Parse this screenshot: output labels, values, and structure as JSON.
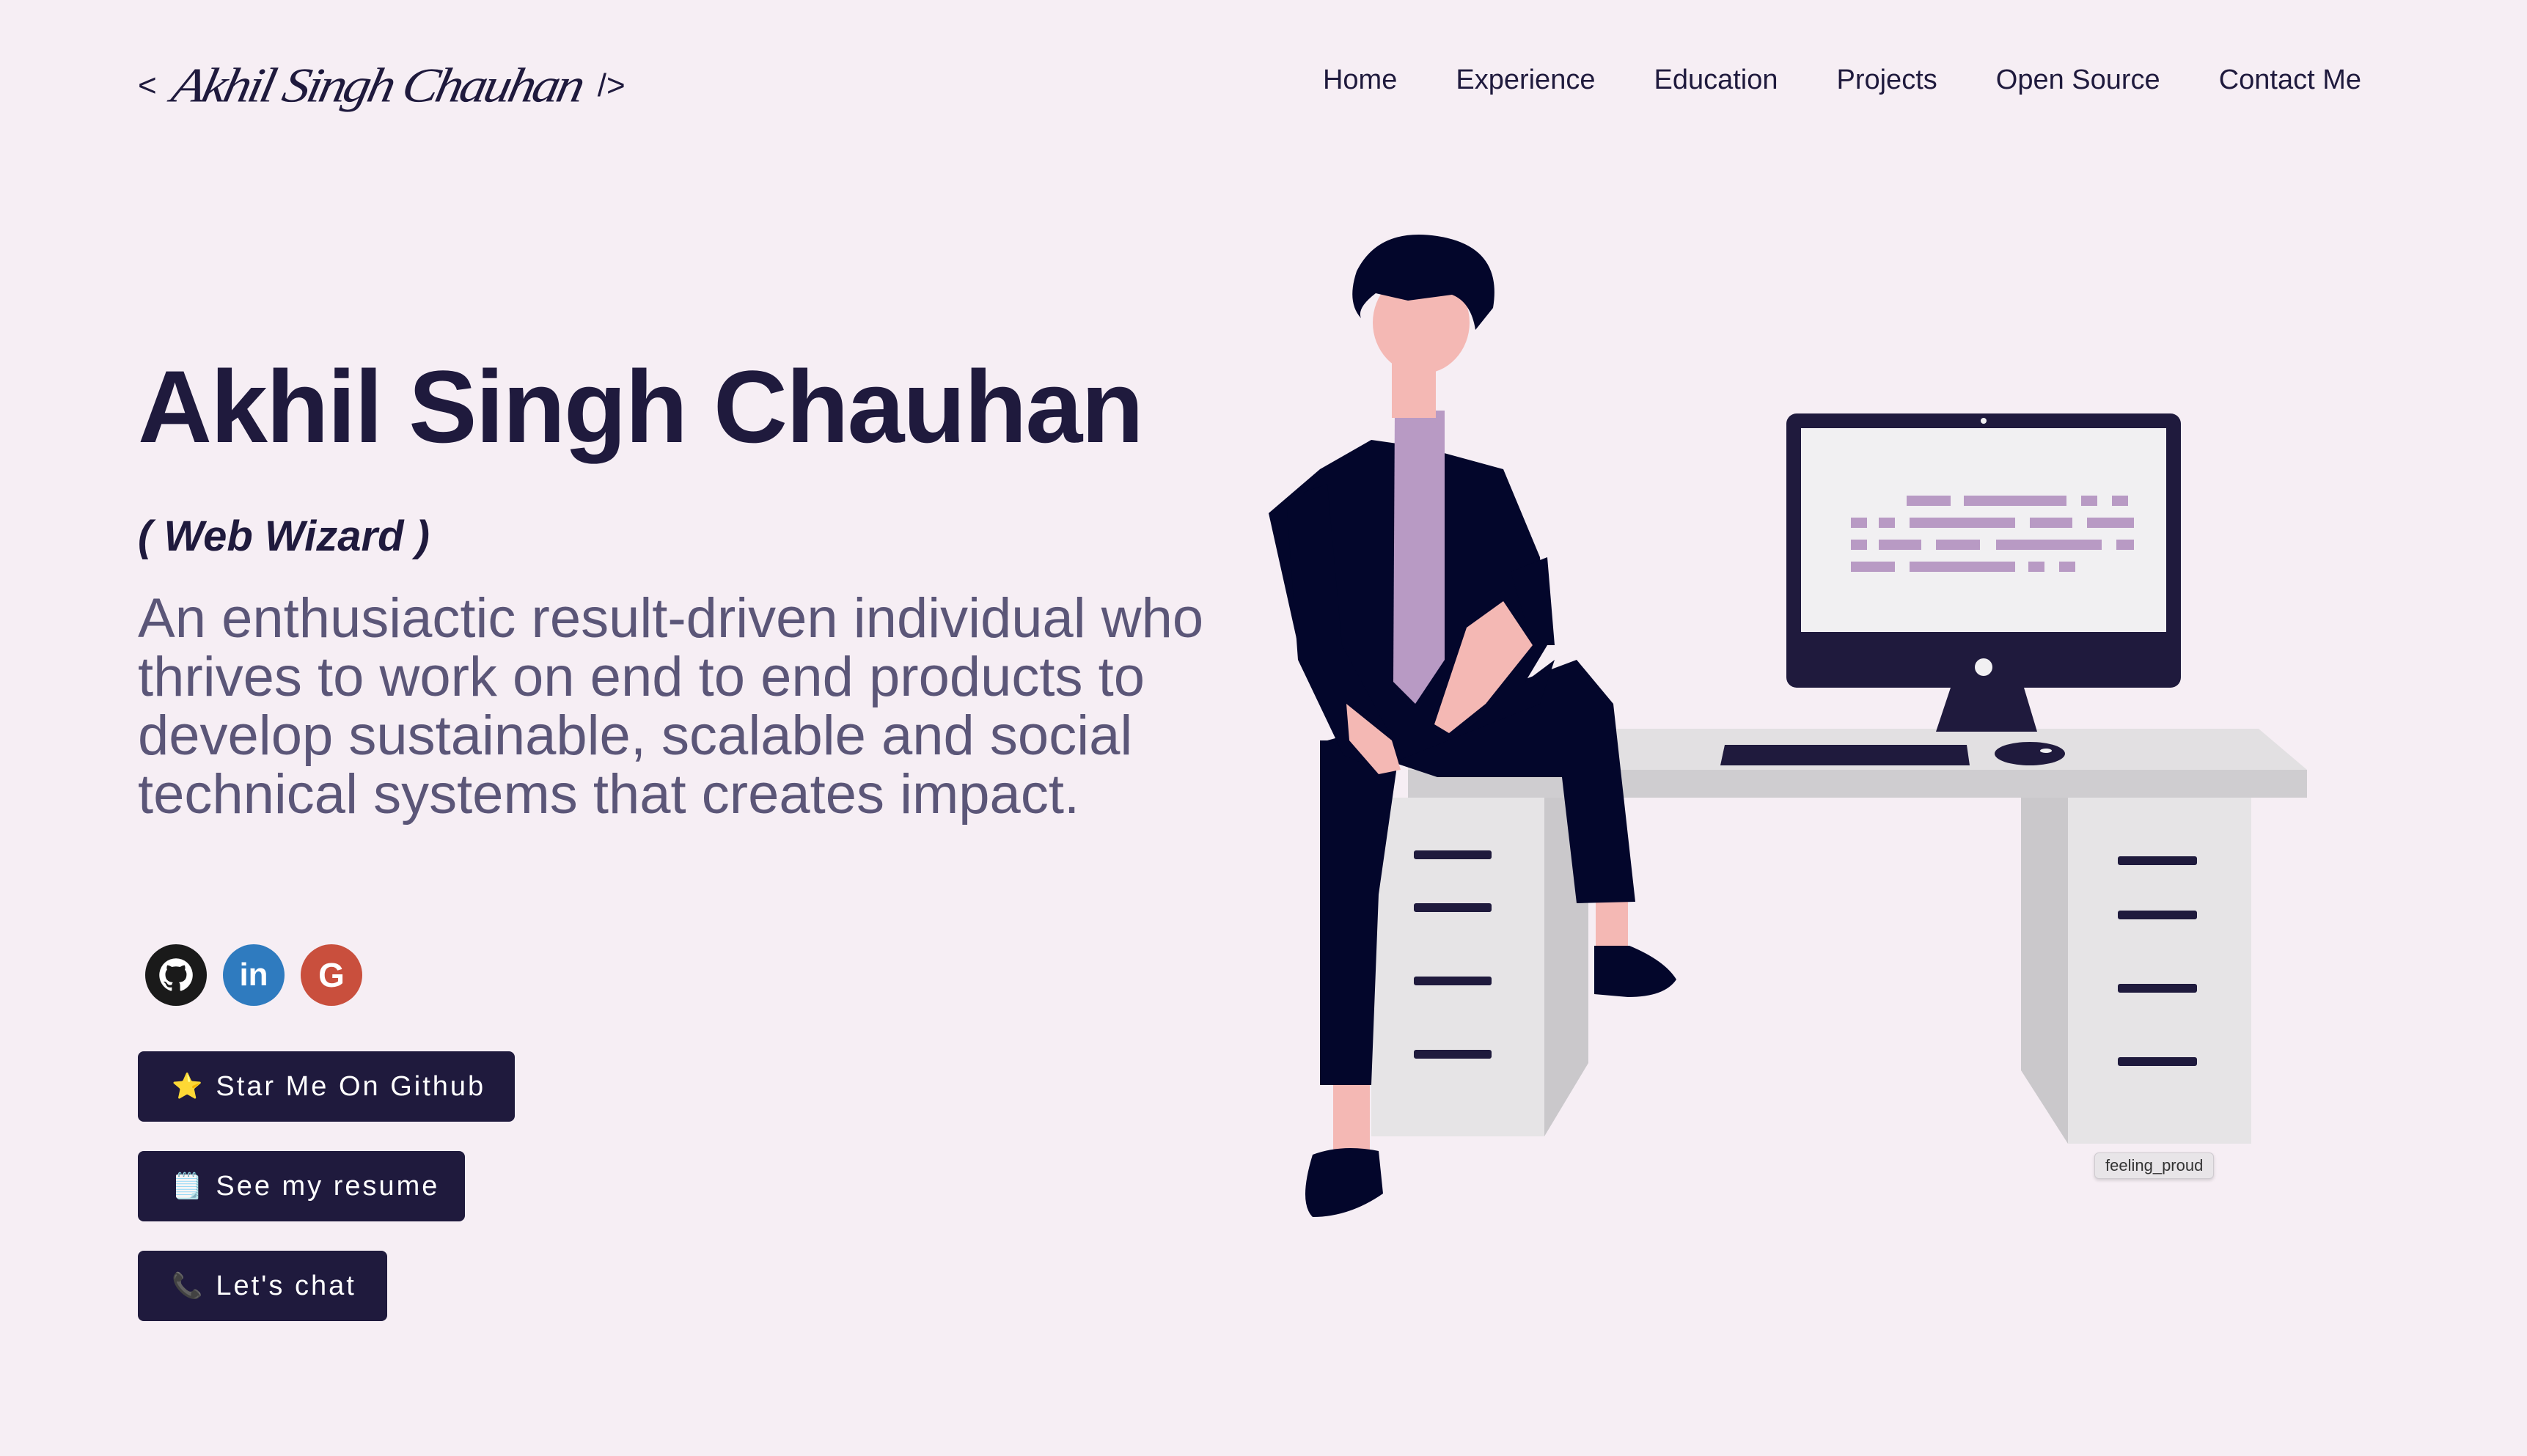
{
  "header": {
    "logo_open": "<",
    "logo_name": "Akhil Singh Chauhan",
    "logo_close": "/>",
    "nav": [
      {
        "label": "Home",
        "active": true
      },
      {
        "label": "Experience",
        "active": false
      },
      {
        "label": "Education",
        "active": false
      },
      {
        "label": "Projects",
        "active": false
      },
      {
        "label": "Open Source",
        "active": false
      },
      {
        "label": "Contact Me",
        "active": false
      }
    ]
  },
  "hero": {
    "title": "Akhil Singh Chauhan",
    "subtitle": "( Web Wizard )",
    "description": "An enthusiactic result-driven individual who thrives to work on end to end products to develop sustainable, scalable and social technical systems that creates impact."
  },
  "socials": [
    {
      "name": "github",
      "icon": "github-icon",
      "color": "#1a1a1a"
    },
    {
      "name": "linkedin",
      "icon": "linkedin-icon",
      "color": "#2f7bbf"
    },
    {
      "name": "google",
      "icon": "google-icon",
      "color": "#c94f3d"
    }
  ],
  "buttons": {
    "github": {
      "emoji": "⭐",
      "label": "Star Me On Github"
    },
    "resume": {
      "emoji": "🗒️",
      "label": "See my resume"
    },
    "chat": {
      "emoji": "📞",
      "label": "Let's chat"
    }
  },
  "illustration": {
    "tooltip": "feeling_proud"
  },
  "colors": {
    "background": "#f6eef4",
    "primary": "#1f1a3d",
    "text_muted": "#5b5678",
    "accent_purple": "#b89ac4"
  }
}
